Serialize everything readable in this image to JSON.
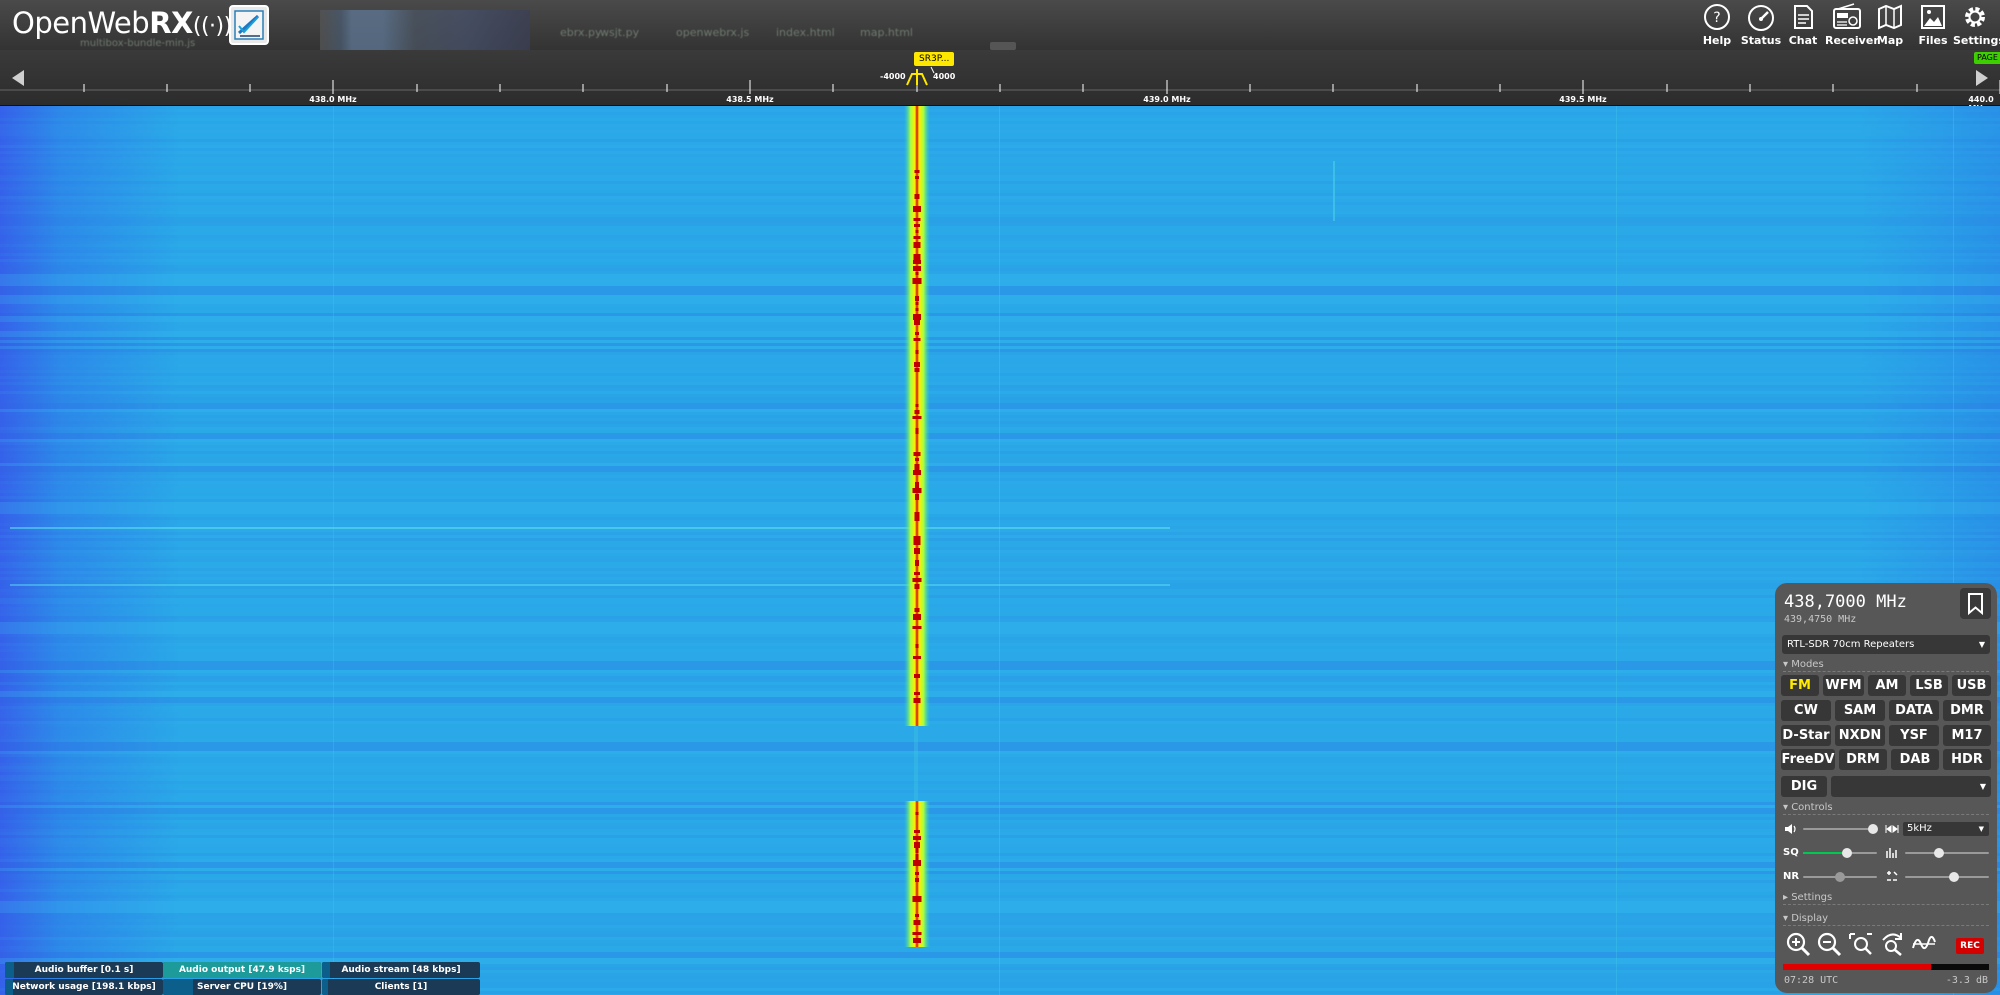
{
  "app": {
    "logo_text": "OpenWeb",
    "logo_rx": "RX",
    "logo_antenna": "((·))"
  },
  "browser_blur": {
    "tabs": [
      "ebrx.py",
      "wsjt.py",
      "openwebrx.js",
      "index.html",
      "map.html"
    ],
    "line": "multibox-bundle-min.js"
  },
  "nav": [
    {
      "label": "Help",
      "icon": "help-icon"
    },
    {
      "label": "Status",
      "icon": "gauge-icon"
    },
    {
      "label": "Chat",
      "icon": "chat-icon"
    },
    {
      "label": "Receiver",
      "icon": "radio-icon"
    },
    {
      "label": "Map",
      "icon": "map-icon"
    },
    {
      "label": "Files",
      "icon": "image-icon"
    },
    {
      "label": "Settings",
      "icon": "gear-icon"
    }
  ],
  "scale": {
    "labels": [
      "438.0 MHz",
      "438.5 MHz",
      "439.0 MHz",
      "439.5 MHz",
      "440.0 MHz"
    ],
    "passband_low": "-4000",
    "passband_high": "4000",
    "bookmark": "SR3P...",
    "page_tag": "PAGE"
  },
  "status_bars": [
    {
      "label": "Audio buffer [0.1 s]",
      "fill": 0.06
    },
    {
      "label": "Audio output [47.9 ksps]",
      "fill": 1.0
    },
    {
      "label": "Audio stream [48 kbps]",
      "fill": 0.05
    },
    {
      "label": "Network usage [198.1 kbps]",
      "fill": 0.05
    },
    {
      "label": "Server CPU [19%]",
      "fill": 0.19
    },
    {
      "label": "Clients [1]",
      "fill": 0.04
    }
  ],
  "panel": {
    "frequency": "438,7000 MHz",
    "sub_frequency": "439,4750 MHz",
    "profile": "RTL-SDR 70cm Repeaters",
    "modes_label": "Modes",
    "modes": [
      "FM",
      "WFM",
      "AM",
      "LSB",
      "USB",
      "CW",
      "SAM",
      "DATA",
      "DMR",
      "D-Star",
      "NXDN",
      "YSF",
      "M17",
      "FreeDV",
      "DRM",
      "DAB",
      "HDR"
    ],
    "active_mode": "FM",
    "dig_label": "DIG",
    "controls_label": "Controls",
    "bandwidth": "5kHz",
    "sq_label": "SQ",
    "nr_label": "NR",
    "volume": 0.95,
    "squelch": 0.6,
    "nr": 0.5,
    "tuning_step": 0.4,
    "agc": 0.58,
    "settings_label": "Settings",
    "display_label": "Display",
    "rec_label": "REC",
    "meter_level": 0.72,
    "utc": "07:28 UTC",
    "db": "-3.3 dB"
  }
}
